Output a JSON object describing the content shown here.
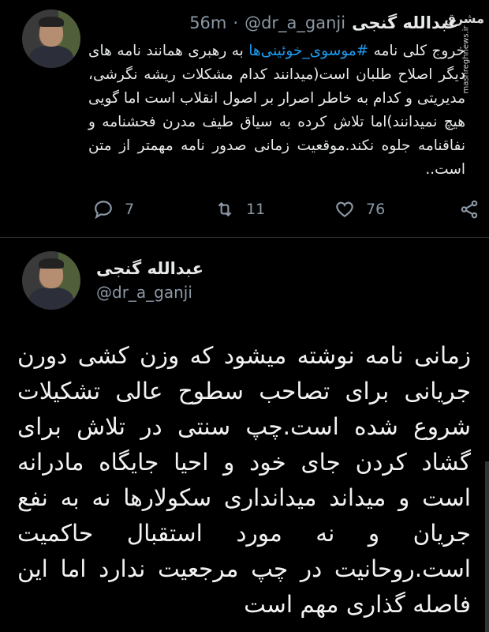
{
  "watermark": {
    "logo": "مشرق",
    "site": "mashreghnews.ir"
  },
  "tweet1": {
    "author_name": "عبدالله گنجی",
    "handle": "@dr_a_ganji",
    "dot": "·",
    "time": "56m",
    "text_before": "خروج کلی نامه ",
    "hashtag": "#موسوی_خوئینی‌ها",
    "text_after": " به رهبری همانند نامه های دیگر اصلاح طلبان است(میدانند کدام مشکلات ریشه نگرشی، مدیریتی و کدام به خاطر اصرار بر اصول انقلاب است اما گویی هیچ نمیدانند)اما تلاش کرده به سیاق طیف مدرن فحشنامه و نفاقنامه جلوه نکند.موقعیت زمانی صدور نامه مهمتر از متن است..",
    "replies": "7",
    "retweets": "11",
    "likes": "76"
  },
  "tweet2": {
    "author_name": "عبدالله گنجی",
    "handle": "@dr_a_ganji",
    "text": "زمانی نامه نوشته میشود که وزن کشی دورن جریانی برای تصاحب سطوح عالی تشکیلات شروع شده است.چپ سنتی در تلاش برای گشاد کردن جای خود و احیا جایگاه مادرانه است و میداند میدانداری سکولارها نه به نفع جریان و نه مورد استقبال حاکمیت است.روحانیت در چپ مرجعیت ندارد اما این فاصله گذاری مهم است"
  },
  "colors": {
    "background": "#000000",
    "text": "#e7e9ea",
    "secondary": "#8b98a5",
    "link": "#1d9bf0"
  },
  "icons": [
    "reply-icon",
    "retweet-icon",
    "like-icon",
    "share-icon"
  ]
}
